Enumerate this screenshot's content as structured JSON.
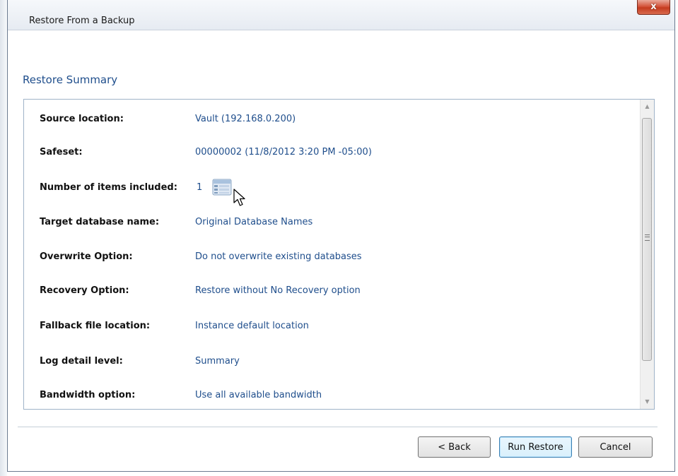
{
  "window": {
    "title": "Restore From a Backup",
    "close_glyph": "x"
  },
  "summary": {
    "heading": "Restore Summary",
    "rows": [
      {
        "label": "Source location:",
        "value": "Vault (192.168.0.200)"
      },
      {
        "label": "Safeset:",
        "value": "00000002 (11/8/2012 3:20 PM -05:00)"
      },
      {
        "label": "Number of items included:",
        "value": "1"
      },
      {
        "label": "Target database name:",
        "value": "Original Database Names"
      },
      {
        "label": "Overwrite Option:",
        "value": "Do not overwrite existing databases"
      },
      {
        "label": "Recovery Option:",
        "value": "Restore without No Recovery option"
      },
      {
        "label": "Fallback file location:",
        "value": "Instance default location"
      },
      {
        "label": "Log detail level:",
        "value": "Summary"
      },
      {
        "label": "Bandwidth option:",
        "value": "Use all available bandwidth"
      }
    ]
  },
  "buttons": {
    "back": "< Back",
    "run_restore": "Run Restore",
    "cancel": "Cancel"
  },
  "icons": {
    "items_list": "item-list-icon",
    "cursor": "mouse-pointer-icon"
  },
  "colors": {
    "accent_text": "#1f4e8c",
    "close_button": "#c43b1f"
  }
}
